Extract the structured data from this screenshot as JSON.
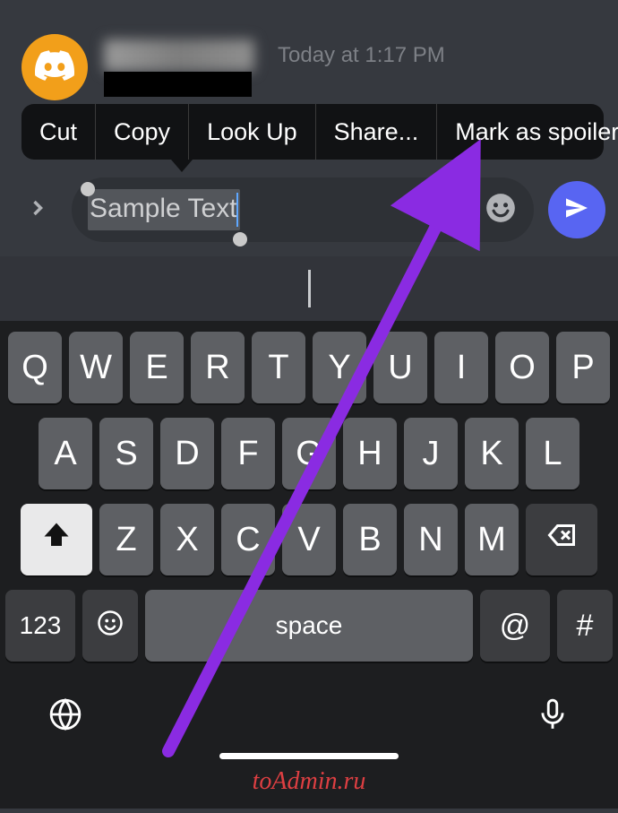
{
  "message": {
    "timestamp": "Today at 1:17 PM"
  },
  "context_menu": [
    "Cut",
    "Copy",
    "Look Up",
    "Share...",
    "Mark as spoiler"
  ],
  "input": {
    "value": "Sample Text"
  },
  "keyboard": {
    "row1": [
      "Q",
      "W",
      "E",
      "R",
      "T",
      "Y",
      "U",
      "I",
      "O",
      "P"
    ],
    "row2": [
      "A",
      "S",
      "D",
      "F",
      "G",
      "H",
      "J",
      "K",
      "L"
    ],
    "row3": [
      "Z",
      "X",
      "C",
      "V",
      "B",
      "N",
      "M"
    ],
    "numbers_key": "123",
    "space_label": "space",
    "at_key": "@",
    "hash_key": "#"
  },
  "watermark": "toAdmin.ru",
  "colors": {
    "send_button": "#5865f2",
    "avatar": "#f29f1a",
    "arrow": "#8a2be2"
  }
}
